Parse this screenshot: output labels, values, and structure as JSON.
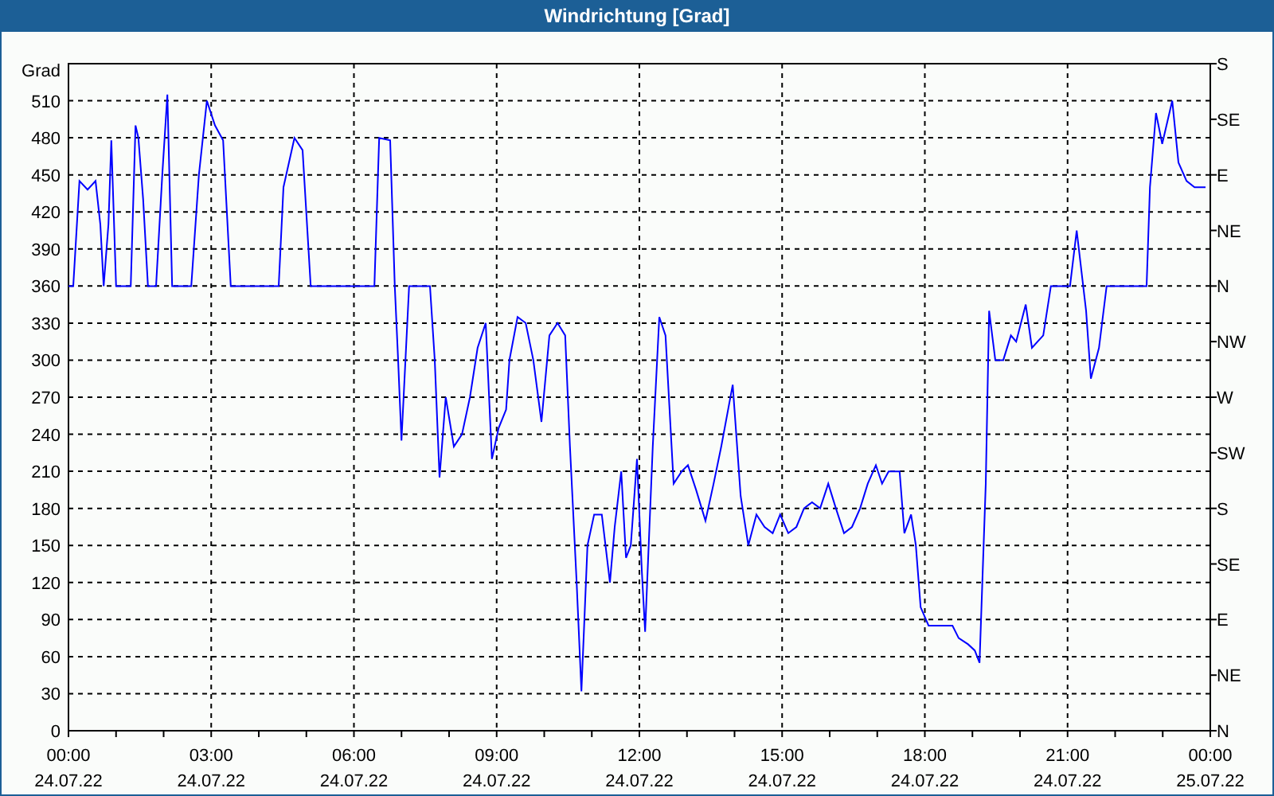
{
  "window": {
    "title": "Windrichtung [Grad]"
  },
  "chart": {
    "chart_data": {
      "type": "line",
      "grid": true,
      "ylabel": "Grad",
      "xlim": [
        0,
        24
      ],
      "ylim": [
        0,
        540
      ],
      "xticks": [
        {
          "value": 0,
          "label": "00:00"
        },
        {
          "value": 3,
          "label": "03:00"
        },
        {
          "value": 6,
          "label": "06:00"
        },
        {
          "value": 9,
          "label": "09:00"
        },
        {
          "value": 12,
          "label": "12:00"
        },
        {
          "value": 15,
          "label": "15:00"
        },
        {
          "value": 18,
          "label": "18:00"
        },
        {
          "value": 21,
          "label": "21:00"
        },
        {
          "value": 24,
          "label": "00:00"
        }
      ],
      "yticks": [
        0,
        30,
        60,
        90,
        120,
        150,
        180,
        210,
        240,
        270,
        300,
        330,
        360,
        390,
        420,
        450,
        480,
        510
      ],
      "x": [
        0,
        0.1,
        0.23,
        0.4,
        0.57,
        0.67,
        0.74,
        0.84,
        0.9,
        1.0,
        1.07,
        1.31,
        1.41,
        1.47,
        1.57,
        1.67,
        1.84,
        1.97,
        2.08,
        2.18,
        2.31,
        2.58,
        2.74,
        2.91,
        3.08,
        3.25,
        3.41,
        4.42,
        4.52,
        4.75,
        4.92,
        5.09,
        6.43,
        6.53,
        6.76,
        6.86,
        6.93,
        7.0,
        7.16,
        7.6,
        7.7,
        7.8,
        7.93,
        8.1,
        8.27,
        8.44,
        8.6,
        8.77,
        8.9,
        9.04,
        9.2,
        9.27,
        9.44,
        9.61,
        9.77,
        9.94,
        10.11,
        10.28,
        10.44,
        10.54,
        10.68,
        10.78,
        10.91,
        11.05,
        11.21,
        11.38,
        11.48,
        11.62,
        11.72,
        11.82,
        11.95,
        12.05,
        12.12,
        12.28,
        12.42,
        12.55,
        12.72,
        12.89,
        13.02,
        13.19,
        13.39,
        13.56,
        13.72,
        13.96,
        14.13,
        14.29,
        14.46,
        14.63,
        14.8,
        14.96,
        15.13,
        15.3,
        15.46,
        15.63,
        15.8,
        15.97,
        16.13,
        16.3,
        16.47,
        16.64,
        16.8,
        16.97,
        17.1,
        17.24,
        17.47,
        17.57,
        17.71,
        17.81,
        17.91,
        18.08,
        18.31,
        18.58,
        18.71,
        18.91,
        19.05,
        19.15,
        19.28,
        19.35,
        19.48,
        19.65,
        19.81,
        19.92,
        20.12,
        20.25,
        20.49,
        20.65,
        21.05,
        21.19,
        21.39,
        21.49,
        21.66,
        21.82,
        22.66,
        22.73,
        22.86,
        22.99,
        23.2,
        23.33,
        23.5,
        23.67,
        23.9
      ],
      "series": [
        {
          "color": "#0000ff",
          "values": [
            360,
            360,
            445,
            438,
            445,
            410,
            360,
            410,
            478,
            360,
            360,
            360,
            490,
            480,
            430,
            360,
            360,
            450,
            515,
            360,
            360,
            360,
            450,
            510,
            490,
            478,
            360,
            360,
            440,
            480,
            470,
            360,
            360,
            480,
            478,
            360,
            300,
            235,
            360,
            360,
            300,
            205,
            270,
            230,
            240,
            270,
            310,
            330,
            220,
            245,
            260,
            300,
            335,
            330,
            300,
            250,
            320,
            330,
            320,
            230,
            120,
            32,
            150,
            175,
            175,
            120,
            165,
            210,
            140,
            150,
            220,
            130,
            80,
            230,
            335,
            320,
            200,
            210,
            215,
            195,
            170,
            200,
            230,
            280,
            190,
            150,
            175,
            165,
            160,
            175,
            160,
            165,
            180,
            185,
            180,
            200,
            180,
            160,
            165,
            180,
            200,
            215,
            200,
            210,
            210,
            160,
            175,
            150,
            100,
            85,
            85,
            85,
            75,
            70,
            65,
            55,
            200,
            340,
            300,
            300,
            320,
            315,
            345,
            310,
            320,
            360,
            360,
            405,
            340,
            285,
            310,
            360,
            360,
            440,
            500,
            475,
            510,
            460,
            445,
            440,
            440
          ]
        }
      ]
    },
    "tick_dates": [
      "24.07.22",
      "24.07.22",
      "24.07.22",
      "24.07.22",
      "24.07.22",
      "24.07.22",
      "24.07.22",
      "24.07.22",
      "25.07.22"
    ],
    "compass_labels": [
      "S",
      "SE",
      "E",
      "NE",
      "N",
      "NW",
      "W",
      "SW",
      "S",
      "SE",
      "E",
      "NE",
      "N"
    ]
  }
}
